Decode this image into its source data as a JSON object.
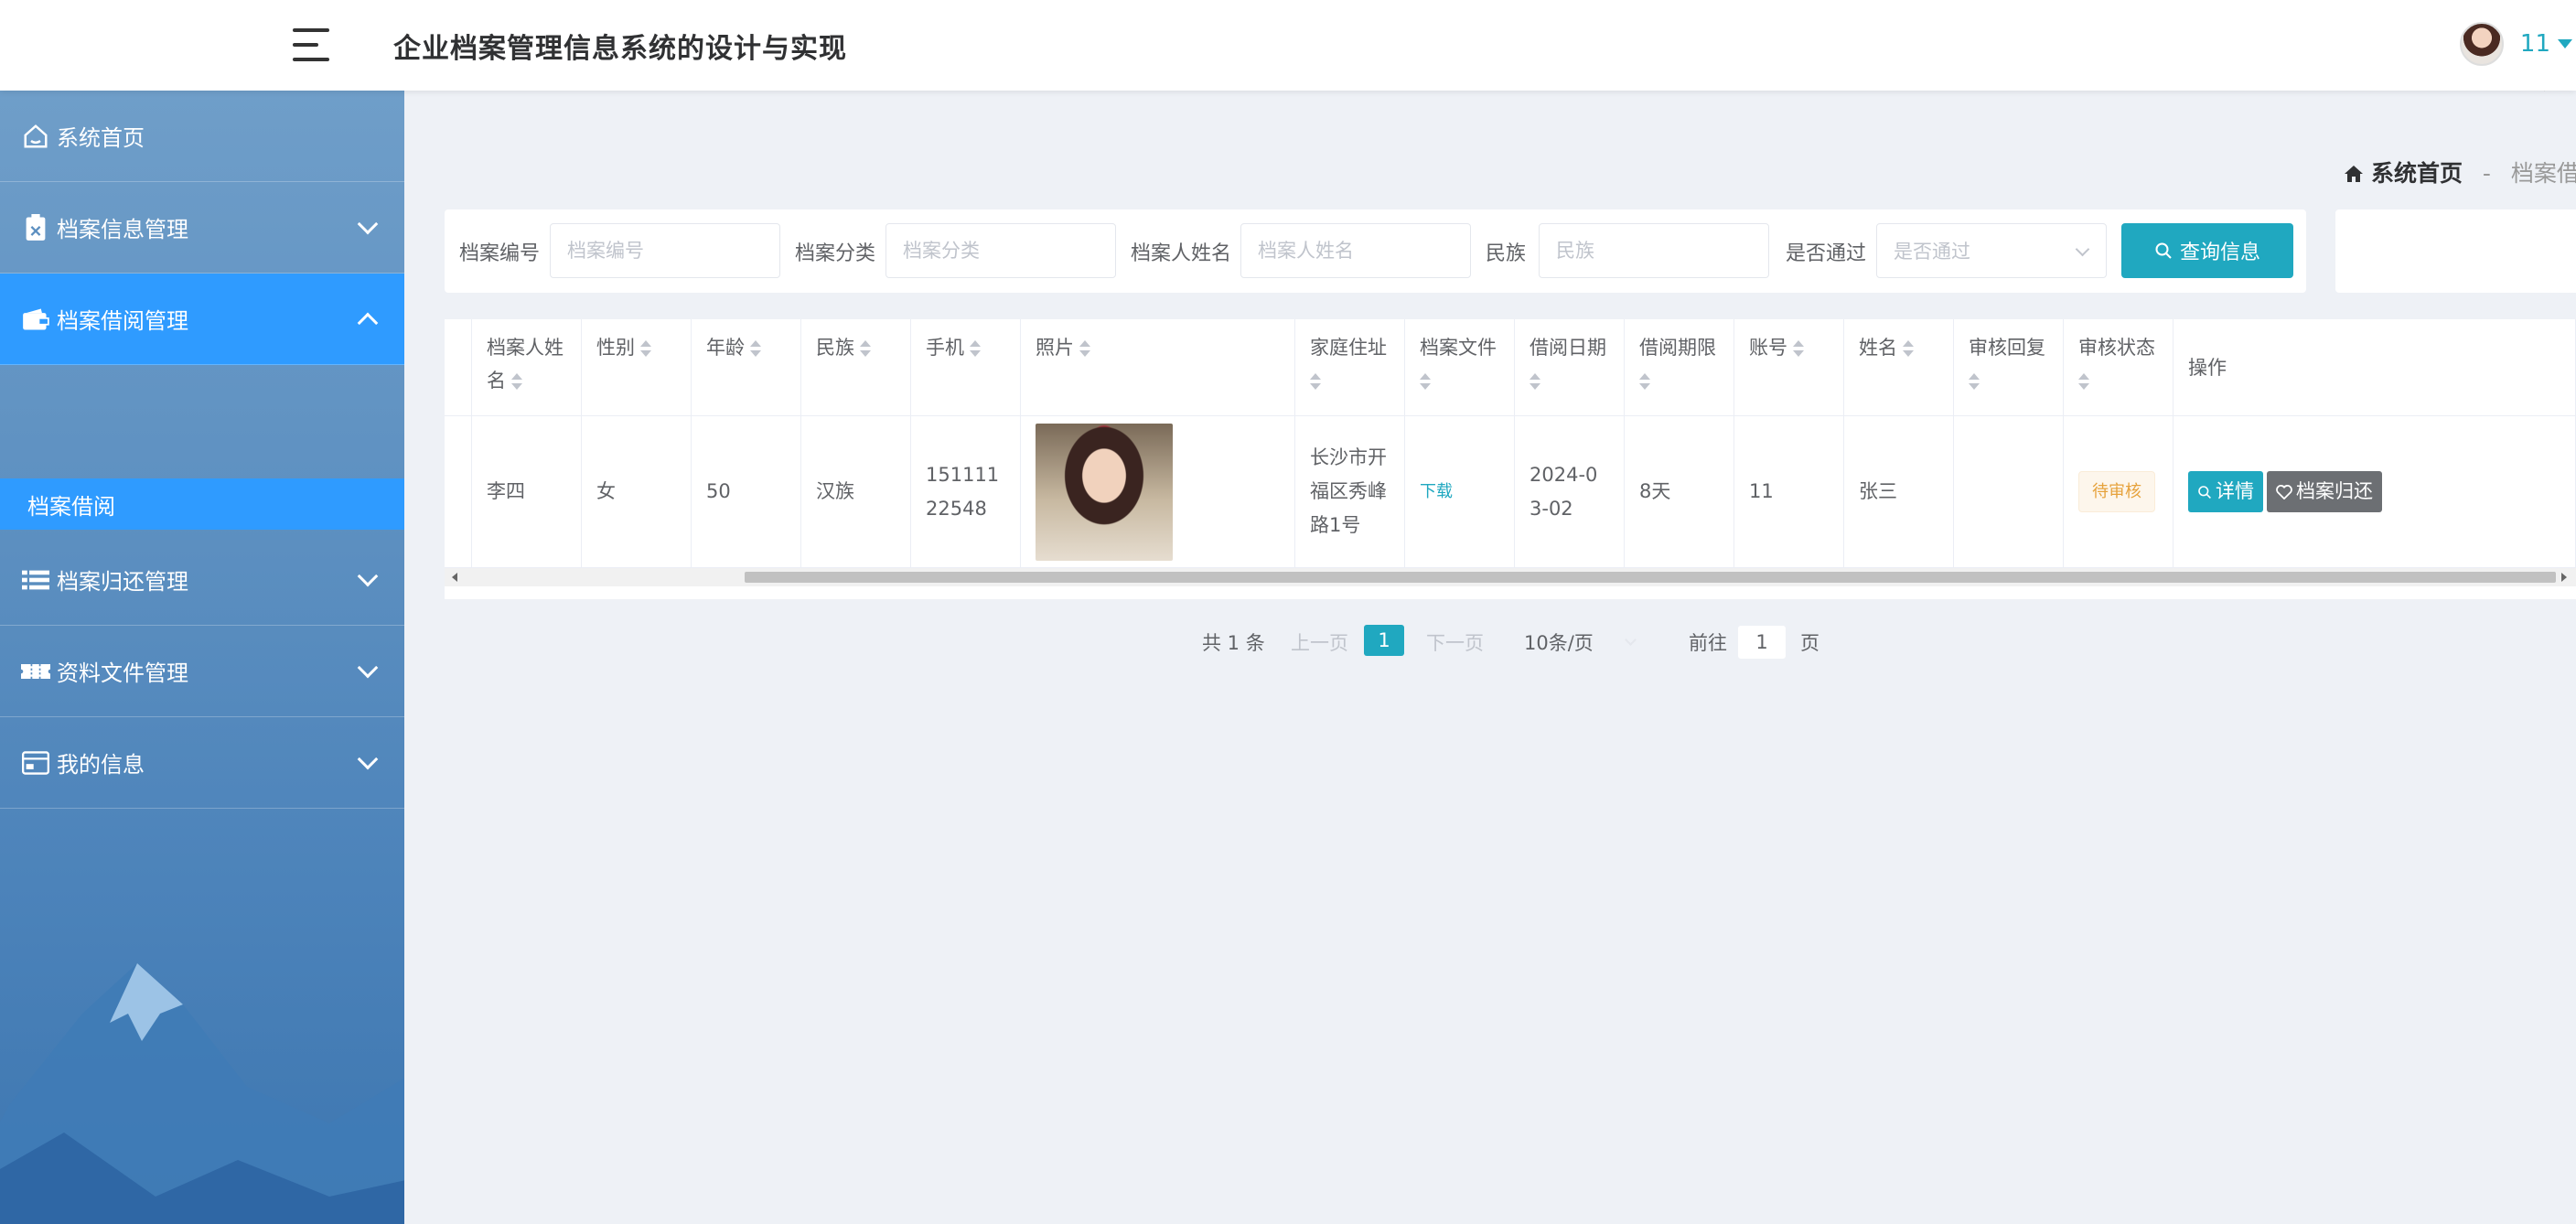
{
  "header": {
    "title": "企业档案管理信息系统的设计与实现",
    "user_name": "11"
  },
  "sidebar": {
    "items": [
      {
        "label": "系统首页",
        "icon": "home-icon"
      },
      {
        "label": "档案信息管理",
        "icon": "clipboard-icon"
      },
      {
        "label": "档案借阅管理",
        "icon": "wallet-icon"
      },
      {
        "label": "档案归还管理",
        "icon": "list-icon"
      },
      {
        "label": "资料文件管理",
        "icon": "ticket-icon"
      },
      {
        "label": "我的信息",
        "icon": "card-icon"
      }
    ],
    "submenu": {
      "label": "档案借阅"
    },
    "active_color": "#2f9bff"
  },
  "breadcrumb": {
    "home": "系统首页",
    "separator": "-",
    "current": "档案借阅"
  },
  "search": {
    "fields": [
      {
        "label": "档案编号",
        "placeholder": "档案编号"
      },
      {
        "label": "档案分类",
        "placeholder": "档案分类"
      },
      {
        "label": "档案人姓名",
        "placeholder": "档案人姓名"
      },
      {
        "label": "民族",
        "placeholder": "民族"
      },
      {
        "label": "是否通过",
        "placeholder": "是否通过"
      }
    ],
    "button": "查询信息",
    "accent": "#20a8c0"
  },
  "table": {
    "headers": {
      "name": "档案人姓名",
      "gender": "性别",
      "age": "年龄",
      "ethnic": "民族",
      "phone": "手机",
      "photo": "照片",
      "address": "家庭住址",
      "file": "档案文件",
      "borrow_date": "借阅日期",
      "period": "借阅期限",
      "account": "账号",
      "realname": "姓名",
      "reply": "审核回复",
      "status": "审核状态",
      "ops": "操作"
    },
    "row": {
      "name": "李四",
      "gender": "女",
      "age": "50",
      "ethnic": "汉族",
      "phone": "15111122548",
      "address": "长沙市开福区秀峰路1号",
      "file": "下载",
      "borrow_date": "2024-03-02",
      "period": "8天",
      "account": "11",
      "realname": "张三",
      "reply": "",
      "status": "待审核",
      "btn_detail": "详情",
      "btn_return": "档案归还"
    }
  },
  "pagination": {
    "total": "共 1 条",
    "prev": "上一页",
    "current_page": "1",
    "next": "下一页",
    "page_size": "10条/页",
    "goto_prefix": "前往",
    "goto_value": "1",
    "goto_suffix": "页"
  }
}
